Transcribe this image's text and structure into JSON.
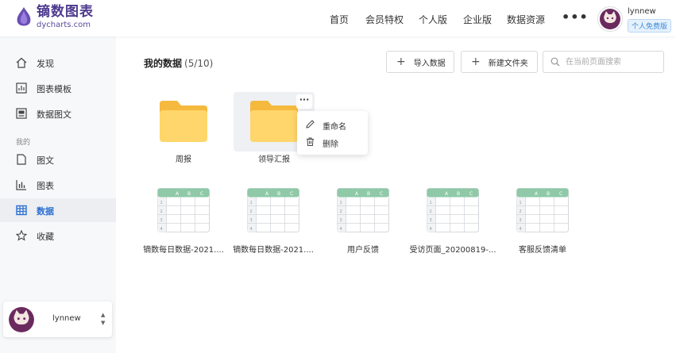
{
  "header": {
    "brand_title": "镝数图表",
    "brand_subtitle": "dycharts.com",
    "nav": [
      "首页",
      "会员特权",
      "个人版",
      "企业版",
      "数据资源"
    ],
    "more": "•••",
    "user_name": "lynnew",
    "user_badge": "个人免费版"
  },
  "sidebar": {
    "items_top": [
      {
        "label": "发现",
        "icon": "home-icon"
      },
      {
        "label": "图表模板",
        "icon": "chart-template-icon"
      },
      {
        "label": "数据图文",
        "icon": "data-article-icon"
      }
    ],
    "group_label": "我的",
    "items_mine": [
      {
        "label": "图文",
        "icon": "document-icon"
      },
      {
        "label": "图表",
        "icon": "bar-chart-icon"
      },
      {
        "label": "数据",
        "icon": "table-icon",
        "active": true
      },
      {
        "label": "收藏",
        "icon": "star-icon"
      }
    ],
    "user_name": "lynnew"
  },
  "main": {
    "title": "我的数据",
    "count": "(5/10)",
    "import_label": "导入数据",
    "new_folder_label": "新建文件夹",
    "search_placeholder": "在当前页面搜索"
  },
  "folders": [
    {
      "name": "周报"
    },
    {
      "name": "领导汇报"
    }
  ],
  "context_menu": {
    "rename": "重命名",
    "delete": "删除"
  },
  "files": [
    {
      "name": "镝数每日数据-2021...."
    },
    {
      "name": "镝数每日数据-2021...."
    },
    {
      "name": "用户反馈"
    },
    {
      "name": "受访页面_20200819-..."
    },
    {
      "name": "客服反馈清单"
    }
  ],
  "colors": {
    "brand": "#4d3a8f",
    "accent": "#2b6ed2",
    "folder": "#ffd66b",
    "sheet_header": "#8fc9a8"
  }
}
